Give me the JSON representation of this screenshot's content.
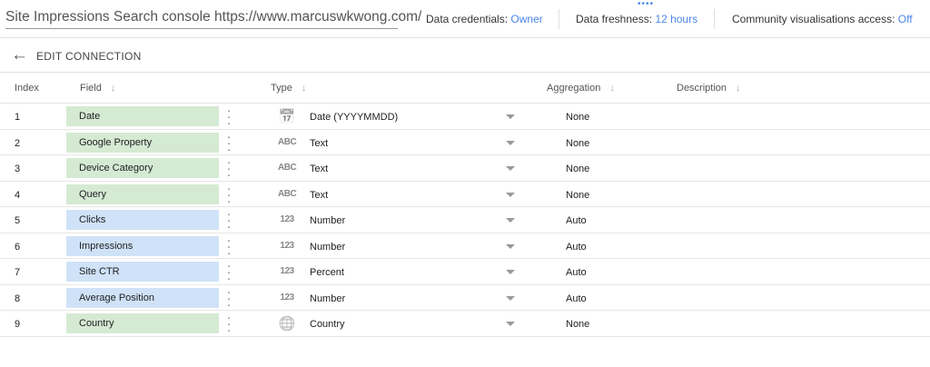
{
  "header": {
    "title": "Site Impressions Search console https://www.marcuswkwong.com/",
    "credentials_label": "Data credentials:",
    "credentials_value": "Owner",
    "freshness_label": "Data freshness:",
    "freshness_value": "12 hours",
    "community_label": "Community visualisations access:",
    "community_value": "Off"
  },
  "toolbar": {
    "edit_label": "EDIT CONNECTION"
  },
  "columns": {
    "index": "Index",
    "field": "Field",
    "type": "Type",
    "aggregation": "Aggregation",
    "description": "Description"
  },
  "colors": {
    "dimension": "#d5ead3",
    "metric": "#cfe2f7",
    "link": "#4a86e8"
  },
  "rows": [
    {
      "index": "1",
      "field": "Date",
      "kind": "dimension",
      "type_icon": "calendar-icon",
      "type": "Date (YYYYMMDD)",
      "aggregation": "None"
    },
    {
      "index": "2",
      "field": "Google Property",
      "kind": "dimension",
      "type_icon": "abc-icon",
      "type": "Text",
      "aggregation": "None"
    },
    {
      "index": "3",
      "field": "Device Category",
      "kind": "dimension",
      "type_icon": "abc-icon",
      "type": "Text",
      "aggregation": "None"
    },
    {
      "index": "4",
      "field": "Query",
      "kind": "dimension",
      "type_icon": "abc-icon",
      "type": "Text",
      "aggregation": "None"
    },
    {
      "index": "5",
      "field": "Clicks",
      "kind": "metric",
      "type_icon": "123-icon",
      "type": "Number",
      "aggregation": "Auto"
    },
    {
      "index": "6",
      "field": "Impressions",
      "kind": "metric",
      "type_icon": "123-icon",
      "type": "Number",
      "aggregation": "Auto"
    },
    {
      "index": "7",
      "field": "Site CTR",
      "kind": "metric",
      "type_icon": "123-icon",
      "type": "Percent",
      "aggregation": "Auto"
    },
    {
      "index": "8",
      "field": "Average Position",
      "kind": "metric",
      "type_icon": "123-icon",
      "type": "Number",
      "aggregation": "Auto"
    },
    {
      "index": "9",
      "field": "Country",
      "kind": "dimension",
      "type_icon": "globe-icon",
      "type": "Country",
      "aggregation": "None"
    }
  ]
}
